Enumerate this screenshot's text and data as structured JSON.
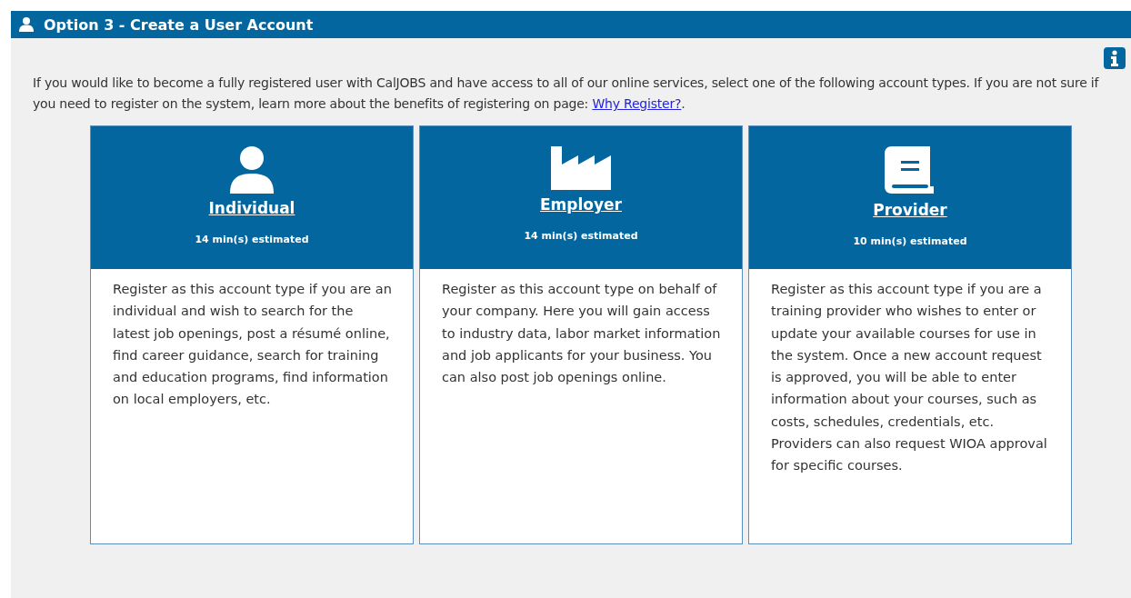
{
  "header": {
    "title": "Option 3 - Create a User Account"
  },
  "intro": {
    "text": "If you would like to become a fully registered user with CalJOBS and have access to all of our online services, select one of the following account types. If you are not sure if you need to register on the system, learn more about the benefits of registering on page: ",
    "link": "Why Register?",
    "suffix": "."
  },
  "cards": [
    {
      "kind": "person",
      "title": "Individual",
      "estimate": "14 min(s) estimated",
      "description": "Register as this account type if you are an individual and wish to search for the latest job openings, post a résumé online, find career guidance, search for training and education programs, find information on local employers, etc."
    },
    {
      "kind": "factory",
      "title": "Employer",
      "estimate": "14 min(s) estimated",
      "description": "Register as this account type on behalf of your company. Here you will gain access to industry data, labor market information and job applicants for your business. You can also post job openings online."
    },
    {
      "kind": "book",
      "title": "Provider",
      "estimate": "10 min(s) estimated",
      "description": "Register as this account type if you are a training provider who wishes to enter or update your available courses for use in the system. Once a new account request is approved, you will be able to enter information about your courses, such as costs, schedules, credentials, etc. Providers can also request WIOA approval for specific courses."
    }
  ]
}
